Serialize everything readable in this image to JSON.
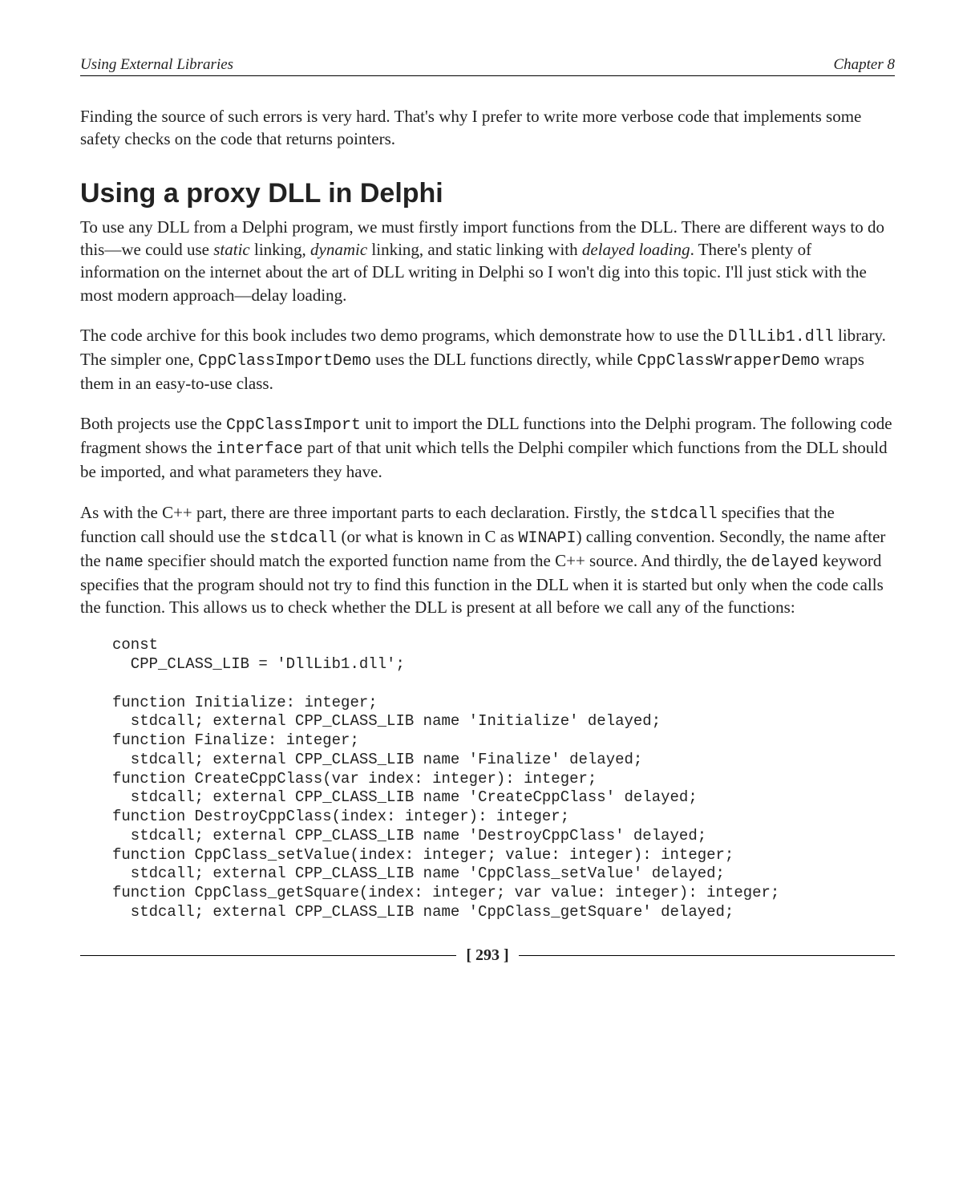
{
  "header": {
    "left": "Using External Libraries",
    "right": "Chapter 8"
  },
  "intro_para": "Finding the source of such errors is very hard. That's why I prefer to write more verbose code that implements some safety checks on the code that returns pointers.",
  "section_title": "Using a proxy DLL in Delphi",
  "p1": {
    "a": "To use any DLL from a Delphi program, we must firstly import functions from the DLL. There are different ways to do this—we could use ",
    "static": "static",
    "b": " linking, ",
    "dynamic": "dynamic",
    "c": " linking, and static linking with ",
    "delayed": "delayed loading",
    "d": ". There's plenty of information on the internet about the art of DLL writing in Delphi so I won't dig into this topic. I'll just stick with the most modern approach—delay loading."
  },
  "p2": {
    "a": "The code archive for this book includes two demo programs, which demonstrate how to use the ",
    "c1": "DllLib1.dll",
    "b": " library. The simpler one, ",
    "c2": "CppClassImportDemo",
    "c": " uses the DLL functions directly, while ",
    "c3": "CppClassWrapperDemo",
    "d": " wraps them in an easy-to-use class."
  },
  "p3": {
    "a": "Both projects use the ",
    "c1": "CppClassImport",
    "b": " unit to import the DLL functions into the Delphi program. The following code fragment shows the ",
    "c2": "interface",
    "c": " part of that unit which tells the Delphi compiler which functions from the DLL should be imported, and what parameters they have."
  },
  "p4": {
    "a": "As with the C++ part, there are three important parts to each declaration. Firstly, the ",
    "c1": "stdcall",
    "b": " specifies that the function call should use the ",
    "c2": "stdcall",
    "c": " (or what is known in C as ",
    "c3": " WINAPI",
    "d": ") calling convention. Secondly, the name after the ",
    "c4": "name",
    "e": " specifier should match the exported function name from the C++ source. And thirdly, the ",
    "c5": "delayed",
    "f": " keyword specifies that the program should not try to find this function in the DLL when it is started but only when the code calls the function. This allows us to check whether the DLL is present at all before we call any of the functions:"
  },
  "code": "const\n  CPP_CLASS_LIB = 'DllLib1.dll';\n\nfunction Initialize: integer;\n  stdcall; external CPP_CLASS_LIB name 'Initialize' delayed;\nfunction Finalize: integer;\n  stdcall; external CPP_CLASS_LIB name 'Finalize' delayed;\nfunction CreateCppClass(var index: integer): integer;\n  stdcall; external CPP_CLASS_LIB name 'CreateCppClass' delayed;\nfunction DestroyCppClass(index: integer): integer;\n  stdcall; external CPP_CLASS_LIB name 'DestroyCppClass' delayed;\nfunction CppClass_setValue(index: integer; value: integer): integer;\n  stdcall; external CPP_CLASS_LIB name 'CppClass_setValue' delayed;\nfunction CppClass_getSquare(index: integer; var value: integer): integer;\n  stdcall; external CPP_CLASS_LIB name 'CppClass_getSquare' delayed;",
  "page_number": "[ 293 ]"
}
